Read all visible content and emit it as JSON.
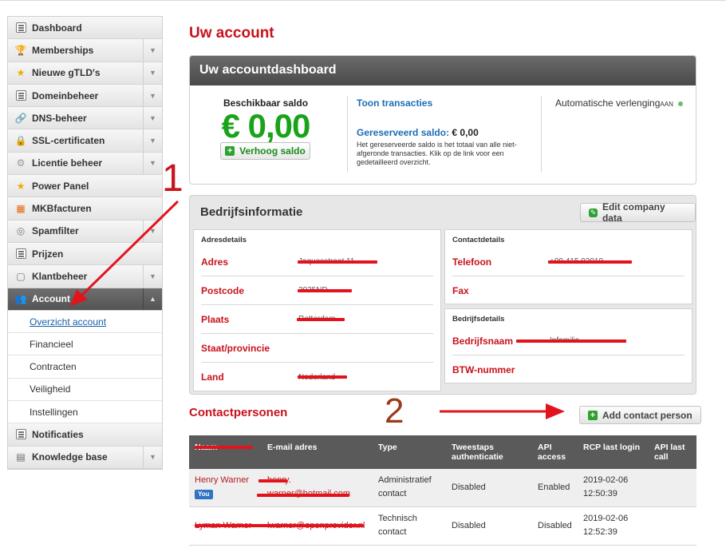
{
  "sidebar": {
    "items": [
      {
        "label": "Dashboard",
        "icon": "dashboard-icon",
        "expandable": false
      },
      {
        "label": "Memberships",
        "icon": "trophy-icon",
        "expandable": true
      },
      {
        "label": "Nieuwe gTLD's",
        "icon": "star-icon",
        "expandable": true
      },
      {
        "label": "Domeinbeheer",
        "icon": "domain-icon",
        "expandable": true
      },
      {
        "label": "DNS-beheer",
        "icon": "link-icon",
        "expandable": true
      },
      {
        "label": "SSL-certificaten",
        "icon": "lock-icon",
        "expandable": true
      },
      {
        "label": "Licentie beheer",
        "icon": "gear-icon",
        "expandable": true
      },
      {
        "label": "Power Panel",
        "icon": "star-icon",
        "expandable": false
      },
      {
        "label": "MKBfacturen",
        "icon": "mkb-icon",
        "expandable": false
      },
      {
        "label": "Spamfilter",
        "icon": "shield-icon",
        "expandable": true
      },
      {
        "label": "Prijzen",
        "icon": "list-icon",
        "expandable": false
      },
      {
        "label": "Klantbeheer",
        "icon": "customer-icon",
        "expandable": true
      }
    ],
    "active": {
      "label": "Account",
      "icon": "users-icon"
    },
    "sub_items": [
      "Overzicht account",
      "Financieel",
      "Contracten",
      "Veiligheid",
      "Instellingen"
    ],
    "after_items": [
      {
        "label": "Notificaties",
        "icon": "list-icon",
        "expandable": false
      },
      {
        "label": "Knowledge base",
        "icon": "book-icon",
        "expandable": true
      }
    ]
  },
  "page": {
    "title": "Uw account"
  },
  "dashboard": {
    "heading": "Uw accountdashboard",
    "balance_label": "Beschikbaar saldo",
    "balance_amount": "€ 0,00",
    "topup_button": "Verhoog saldo",
    "transactions_link": "Toon transacties",
    "reserved_label": "Gereserveerd saldo:",
    "reserved_value": "€ 0,00",
    "reserved_note": "Het gereserveerde saldo is het totaal van alle niet-afgeronde transacties. Klik op de link voor een gedetailleerd overzicht.",
    "auto_renew_label": "Automatische verlenging",
    "auto_renew_state": "AAN"
  },
  "company": {
    "heading": "Bedrijfsinformatie",
    "edit_button": "Edit company data",
    "address": {
      "title": "Adresdetails",
      "fields": [
        {
          "label": "Adres",
          "value": "Jaquesstraat 11"
        },
        {
          "label": "Postcode",
          "value": "3025ND"
        },
        {
          "label": "Plaats",
          "value": "Rotterdam"
        },
        {
          "label": "Staat/provincie",
          "value": ""
        },
        {
          "label": "Land",
          "value": "Nederland"
        }
      ]
    },
    "contact": {
      "title": "Contactdetails",
      "fields": [
        {
          "label": "Telefoon",
          "value": "+09 415 92019"
        },
        {
          "label": "Fax",
          "value": ""
        }
      ]
    },
    "business": {
      "title": "Bedrijfsdetails",
      "fields": [
        {
          "label": "Bedrijfsnaam",
          "value": "Infamilia"
        },
        {
          "label": "BTW-nummer",
          "value": ""
        }
      ]
    }
  },
  "contacts": {
    "heading": "Contactpersonen",
    "add_button": "Add contact person",
    "columns": [
      "Naam",
      "E-mail adres",
      "Type",
      "Tweestaps authenticatie",
      "API access",
      "RCP last login",
      "API last call"
    ],
    "rows": [
      {
        "name": "Henry Warner",
        "badge": "You",
        "email_line1": "henry.",
        "email_line2": "warner@hotmail.com",
        "type": "Administratief contact",
        "two_factor": "Disabled",
        "api_access": "Enabled",
        "rcp_date": "2019-02-06",
        "rcp_time": "12:50:39",
        "api_last_call": ""
      },
      {
        "name": "Lyman Warner",
        "badge": "",
        "email_line1": "lwarner@openprovider.nl",
        "email_line2": "",
        "type": "Technisch contact",
        "two_factor": "Disabled",
        "api_access": "Disabled",
        "rcp_date": "2019-02-06",
        "rcp_time": "12:52:39",
        "api_last_call": ""
      }
    ]
  },
  "annotations": {
    "label_1": "1",
    "label_2": "2"
  },
  "colors": {
    "accent_red": "#c8121c",
    "link_blue": "#1a6db5",
    "balance_green": "#1aa31a",
    "redaction": "#e3131c"
  }
}
